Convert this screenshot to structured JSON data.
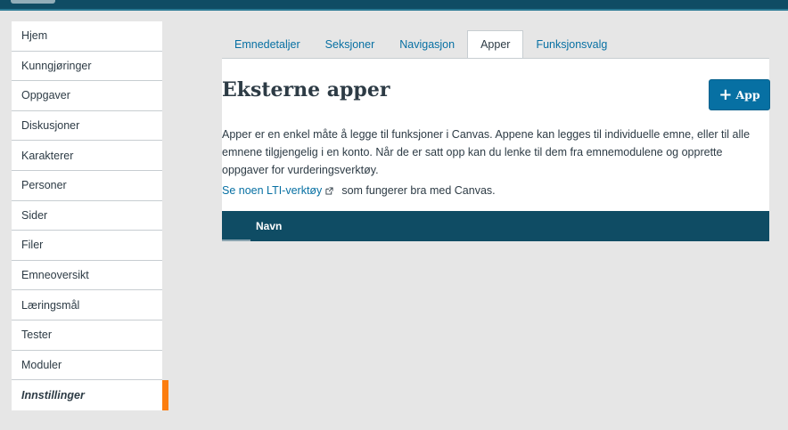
{
  "sidebar": {
    "items": [
      {
        "label": "Hjem"
      },
      {
        "label": "Kunngjøringer"
      },
      {
        "label": "Oppgaver"
      },
      {
        "label": "Diskusjoner"
      },
      {
        "label": "Karakterer"
      },
      {
        "label": "Personer"
      },
      {
        "label": "Sider"
      },
      {
        "label": "Filer"
      },
      {
        "label": "Emneoversikt"
      },
      {
        "label": "Læringsmål"
      },
      {
        "label": "Tester"
      },
      {
        "label": "Moduler"
      },
      {
        "label": "Innstillinger",
        "active": true
      }
    ]
  },
  "tabs": [
    {
      "label": "Emnedetaljer"
    },
    {
      "label": "Seksjoner"
    },
    {
      "label": "Navigasjon"
    },
    {
      "label": "Apper",
      "active": true
    },
    {
      "label": "Funksjonsvalg"
    }
  ],
  "main": {
    "title": "Eksterne apper",
    "add_button_label": "App",
    "description": "Apper er en enkel måte å legge til funksjoner i Canvas. Appene kan legges til individuelle emne, eller til alle emnene tilgjengelig i en konto. Når de er satt opp kan du lenke til dem fra emnemodulene og opprette oppgaver for vurderingsverktøy.",
    "lti_link_text": "Se noen LTI-verktøy",
    "lti_suffix": "som fungerer bra med Canvas.",
    "table": {
      "columns": [
        "",
        "Navn"
      ]
    }
  },
  "colors": {
    "brand_dark": "#0f4c64",
    "link": "#0770a3",
    "active_marker": "#fc7d0f",
    "background": "#e6e6e6"
  },
  "icons": {
    "add_button": "plus-icon",
    "external_link": "external-link-icon"
  }
}
